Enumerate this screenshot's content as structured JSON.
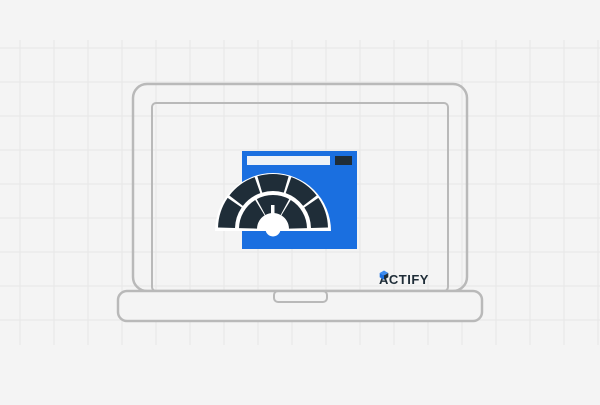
{
  "brand": {
    "name": "ACTIFY",
    "logo_icon": "cube-logo-icon",
    "text_color": "#1f2d38",
    "accent_color": "#1a6fe0"
  },
  "illustration": {
    "laptop_icon": "laptop-icon",
    "browser_window_icon": "browser-window-icon",
    "gauge_icon": "speedometer-gauge-icon",
    "screen_color": "#1a6fe0",
    "gauge_color": "#1f2d38",
    "outline_color": "#b9b9b9",
    "grid_color": "#e6e6e6",
    "background_color": "#f4f4f4"
  }
}
